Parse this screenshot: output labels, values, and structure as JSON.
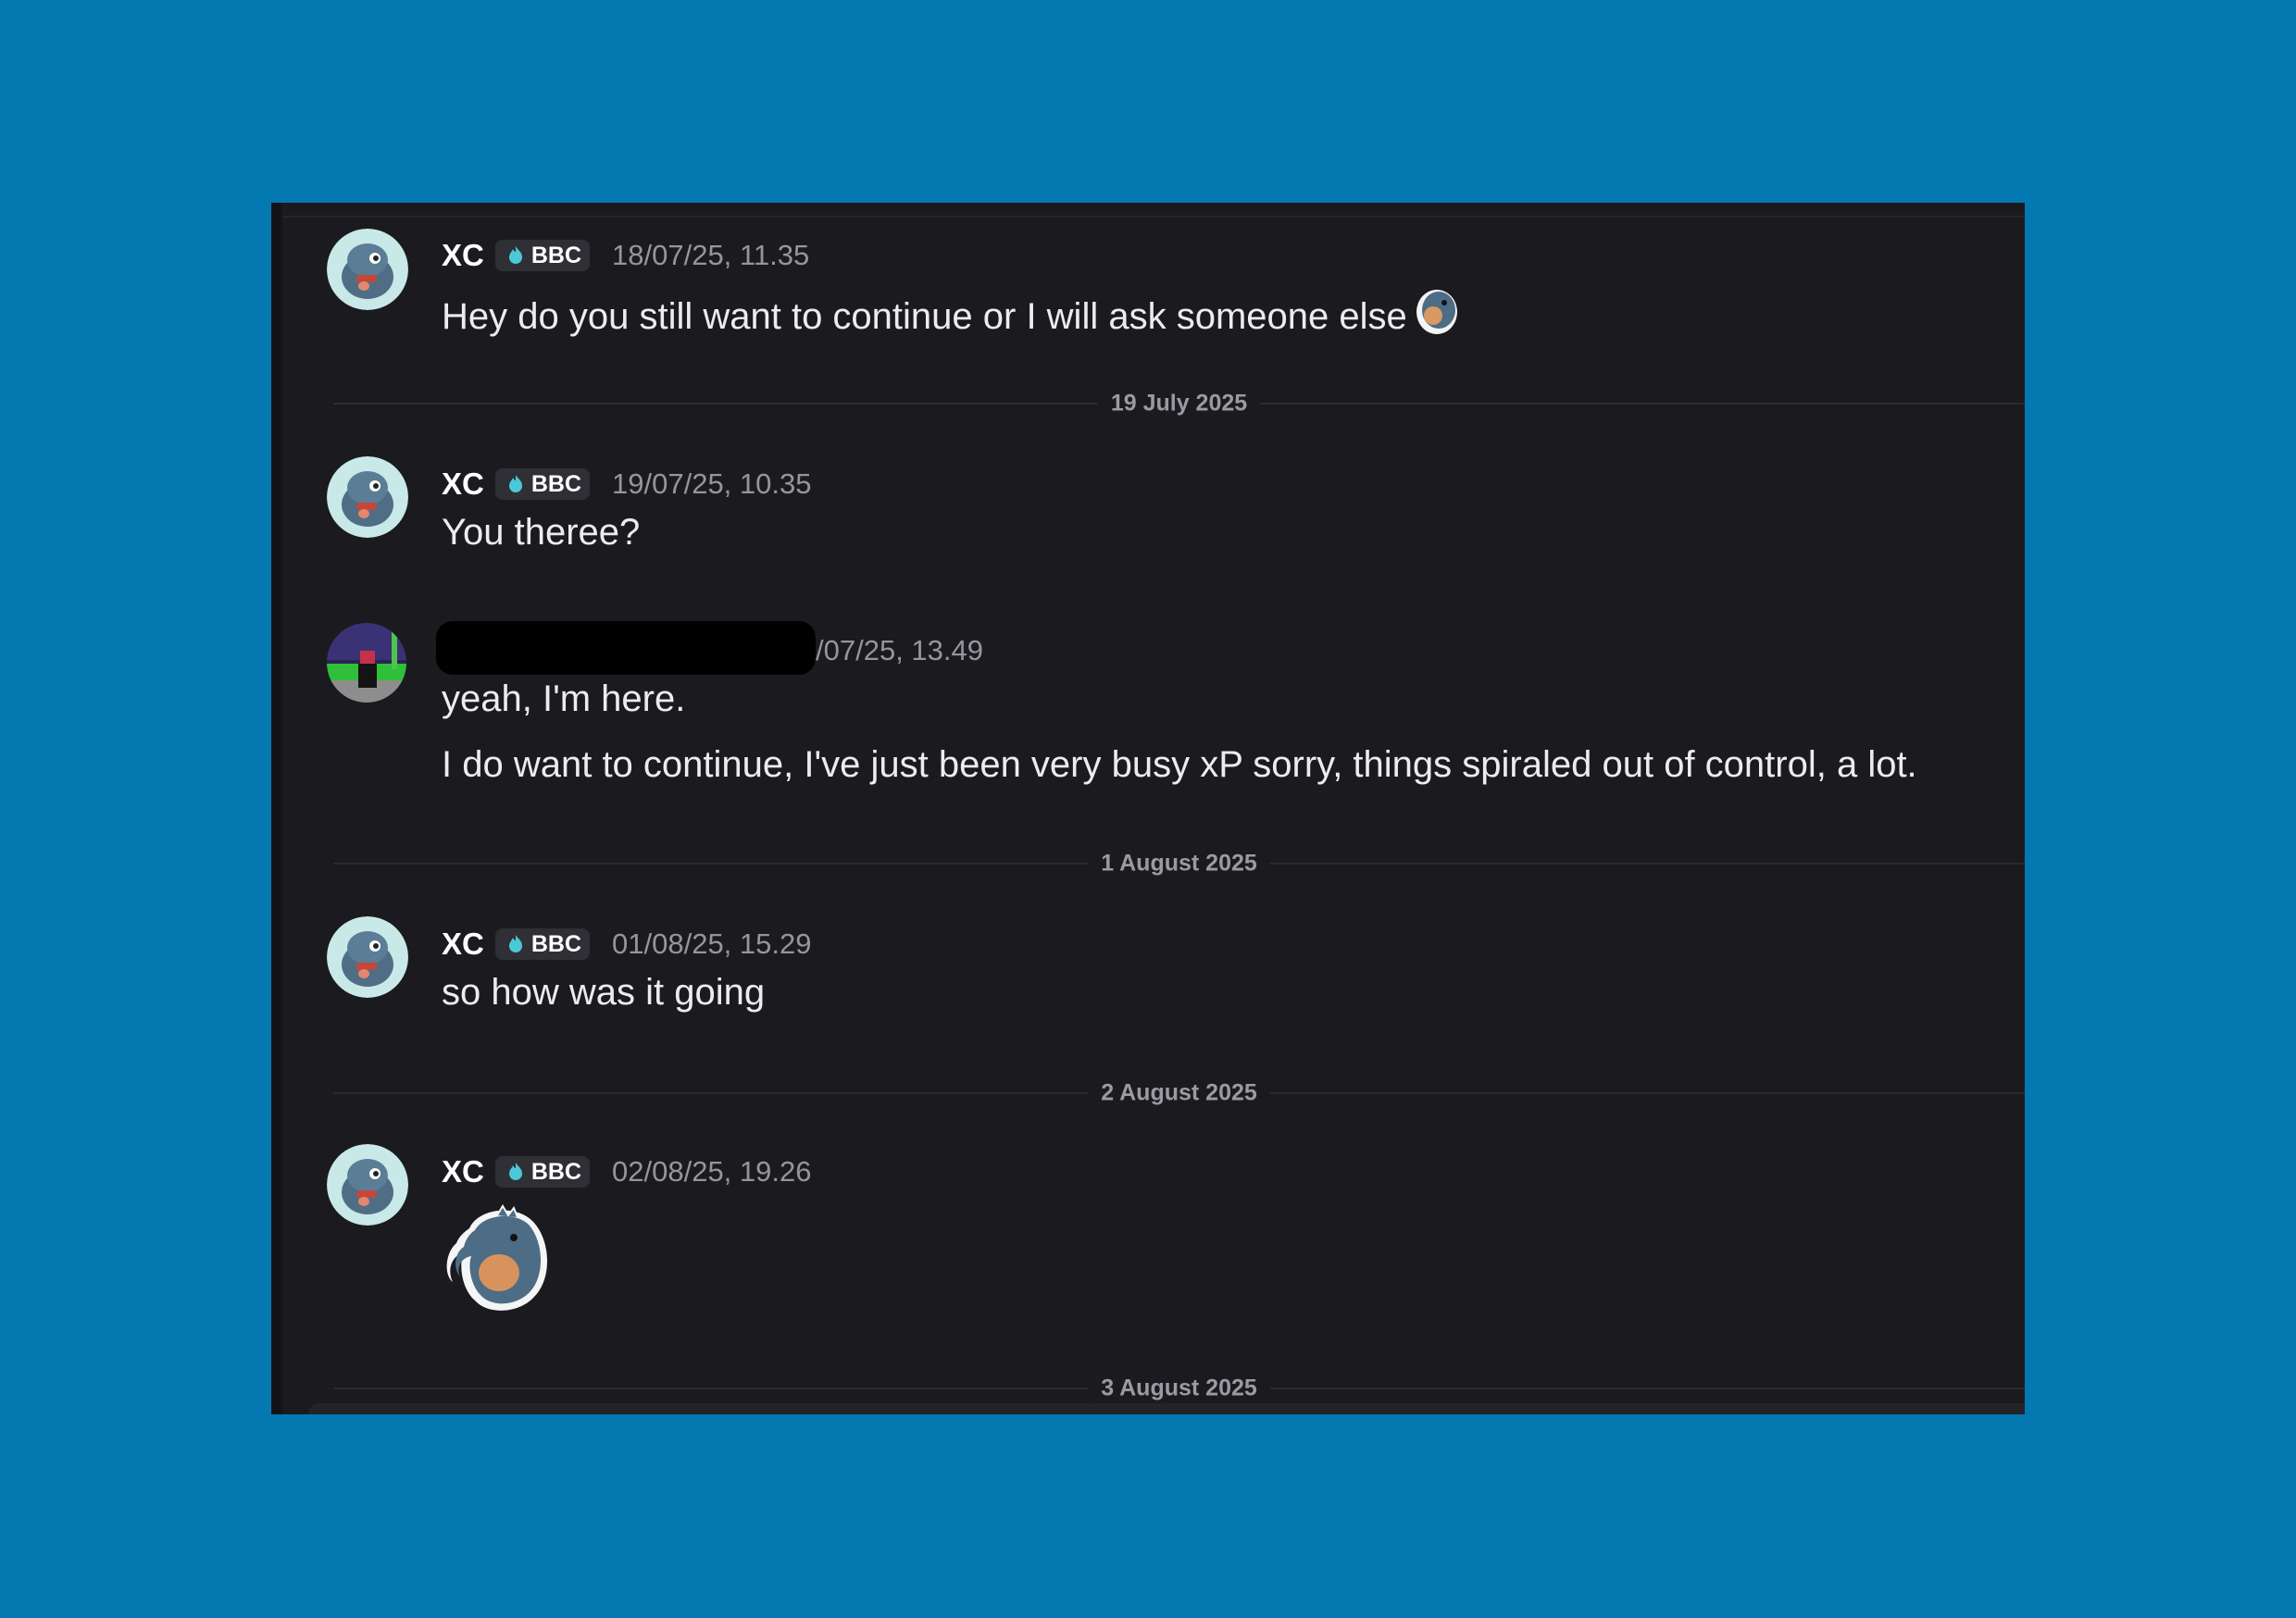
{
  "messages": [
    {
      "username": "XC",
      "tag": "BBC",
      "timestamp": "18/07/25, 11.35",
      "text": "Hey do you still want to continue or I will ask someone else"
    },
    {
      "username": "XC",
      "tag": "BBC",
      "timestamp": "19/07/25, 10.35",
      "text": "You theree?"
    },
    {
      "timestamp_visible": "/07/25, 13.49",
      "lines": [
        "yeah, I'm here.",
        "I do want to continue, I've just been very busy xP sorry, things spiraled out of control, a lot."
      ]
    },
    {
      "username": "XC",
      "tag": "BBC",
      "timestamp": "01/08/25, 15.29",
      "text": "so how was it going"
    },
    {
      "username": "XC",
      "tag": "BBC",
      "timestamp": "02/08/25, 19.26",
      "sticker": "dinosaur-sticker"
    }
  ],
  "dividers": [
    "19 July 2025",
    "1 August 2025",
    "2 August 2025",
    "3 August 2025"
  ],
  "icons": {
    "tag_icon": "flame-icon",
    "sticker": "dinosaur-sticker-icon"
  },
  "colors": {
    "background": "#0479b1",
    "chat_bg": "#1b1b1f",
    "tag_icon": "#4cc9d6"
  }
}
